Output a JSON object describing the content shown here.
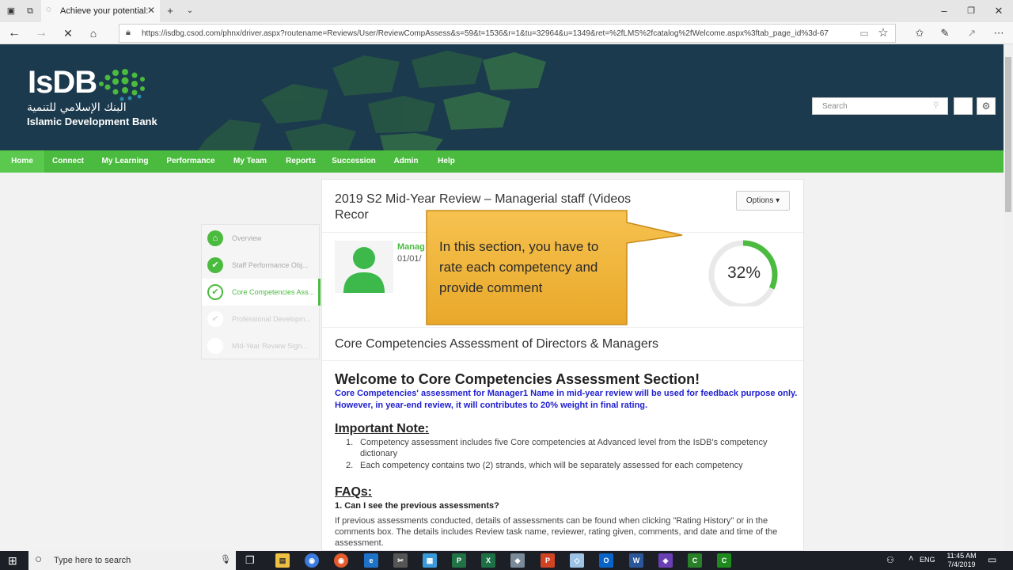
{
  "browser": {
    "tab_title": "Achieve your potential:",
    "url": "https://isdbg.csod.com/phnx/driver.aspx?routename=Reviews/User/ReviewCompAssess&s=59&t=1536&r=1&tu=32964&u=1349&ret=%2fLMS%2fcatalog%2fWelcome.aspx%3ftab_page_id%3d-67"
  },
  "header": {
    "logo_main": "IsDB",
    "logo_arabic": "البنك الإسلامي للتنمية",
    "logo_sub": "Islamic Development Bank",
    "search_placeholder": "Search"
  },
  "nav": {
    "items": [
      "Home",
      "Connect",
      "My Learning",
      "Performance",
      "My Team",
      "Reports",
      "Succession",
      "Admin",
      "Help"
    ]
  },
  "steps": [
    {
      "label": "Overview",
      "state": "done"
    },
    {
      "label": "Staff Performance Obj...",
      "state": "done"
    },
    {
      "label": "Core Competencies Ass...",
      "state": "current"
    },
    {
      "label": "Professional Developm...",
      "state": "pending"
    },
    {
      "label": "Mid-Year Review Sign...",
      "state": "pending"
    }
  ],
  "card": {
    "title": "2019 S2 Mid-Year Review – Managerial staff (Videos Recor",
    "options_label": "Options ▾",
    "person_name": "Manag",
    "person_date": "01/01/",
    "progress_label": "32%",
    "progress_value": 0.32,
    "section_title": "Core Competencies Assessment of Directors & Managers",
    "welcome_title": "Welcome to Core Competencies Assessment Section!",
    "welcome_sub": "Core Competencies' assessment for Manager1 Name in mid-year review will be used for feedback purpose only. However, in year-end review, it will contributes to 20% weight in final rating.",
    "note_title": "Important Note:",
    "notes": [
      {
        "num": "1.",
        "text": "Competency assessment includes five Core competencies at Advanced level from the IsDB's competency dictionary"
      },
      {
        "num": "2.",
        "text": "Each competency contains two (2) strands, which will be separately assessed for each competency"
      }
    ],
    "faq_title": "FAQs:",
    "faq_q1": "1. Can I see the previous assessments?",
    "faq_a1": "If previous assessments conducted, details of assessments can be found when clicking \"Rating History\" or in the comments box. The details includes Review task name, reviewer, rating given, comments, and date and time of the assessment."
  },
  "callout": {
    "text": "In this section, you have to rate each competency and provide comment"
  },
  "taskbar": {
    "search_placeholder": "Type here to search",
    "lang": "ENG",
    "time": "11:45 AM",
    "date": "7/4/2019"
  },
  "colors": {
    "brand_green": "#4bbb3f",
    "header_dark": "#1c3a4d",
    "callout_orange": "#f0b43c",
    "link_blue": "#1f1fd1"
  }
}
